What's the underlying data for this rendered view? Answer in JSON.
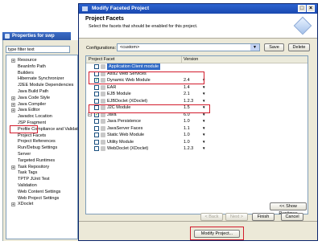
{
  "background_window": {
    "title": "Properties for swp",
    "filter_text": "type filter text",
    "tree": [
      {
        "label": "Resource",
        "expandable": true
      },
      {
        "label": "BeanInfo Path",
        "expandable": false
      },
      {
        "label": "Builders",
        "expandable": false
      },
      {
        "label": "Hibernate Synchronizer",
        "expandable": false
      },
      {
        "label": "J2EE Module Dependencies",
        "expandable": false
      },
      {
        "label": "Java Build Path",
        "expandable": false
      },
      {
        "label": "Java Code Style",
        "expandable": true
      },
      {
        "label": "Java Compiler",
        "expandable": true
      },
      {
        "label": "Java Editor",
        "expandable": true
      },
      {
        "label": "Javadoc Location",
        "expandable": false
      },
      {
        "label": "JSP Fragment",
        "expandable": false
      },
      {
        "label": "Profile Compliance and Validatio",
        "expandable": false
      },
      {
        "label": "Project Facets",
        "expandable": false
      },
      {
        "label": "Project References",
        "expandable": false
      },
      {
        "label": "Run/Debug Settings",
        "expandable": false
      },
      {
        "label": "Server",
        "expandable": false
      },
      {
        "label": "Targeted Runtimes",
        "expandable": false
      },
      {
        "label": "Task Repository",
        "expandable": true
      },
      {
        "label": "Task Tags",
        "expandable": false
      },
      {
        "label": "TPTP JUnit Test",
        "expandable": false
      },
      {
        "label": "Validation",
        "expandable": false
      },
      {
        "label": "Web Content Settings",
        "expandable": false
      },
      {
        "label": "Web Project Settings",
        "expandable": false
      },
      {
        "label": "XDoclet",
        "expandable": true
      }
    ]
  },
  "dialog": {
    "title": "Modify Faceted Project",
    "heading": "Project Facets",
    "description": "Select the facets that should be enabled for this project.",
    "config_label": "Configurations:",
    "config_value": "<custom>",
    "save_label": "Save",
    "delete_label": "Delete",
    "col_facet": "Project Facet",
    "col_version": "Version",
    "facets": [
      {
        "name": "Application Client module",
        "version": "",
        "checked": false,
        "selected": true
      },
      {
        "name": "Axis2 Web Services",
        "version": "",
        "checked": false,
        "selected": false
      },
      {
        "name": "Dynamic Web Module",
        "version": "2.4",
        "checked": true,
        "selected": false
      },
      {
        "name": "EAR",
        "version": "1.4",
        "checked": false,
        "selected": false
      },
      {
        "name": "EJB Module",
        "version": "2.1",
        "checked": false,
        "selected": false
      },
      {
        "name": "EJBDoclet (XDoclet)",
        "version": "1.2.3",
        "checked": false,
        "selected": false
      },
      {
        "name": "J2C Module",
        "version": "1.5",
        "checked": false,
        "selected": false
      },
      {
        "name": "Java",
        "version": "6.0",
        "checked": true,
        "selected": false
      },
      {
        "name": "Java Persistence",
        "version": "1.0",
        "checked": false,
        "selected": false
      },
      {
        "name": "JavaServer Faces",
        "version": "1.1",
        "checked": false,
        "selected": false
      },
      {
        "name": "Static Web Module",
        "version": "1.0",
        "checked": false,
        "selected": false
      },
      {
        "name": "Utility Module",
        "version": "1.0",
        "checked": false,
        "selected": false
      },
      {
        "name": "WebDoclet (XDoclet)",
        "version": "1.2.3",
        "checked": false,
        "selected": false
      }
    ],
    "show_runtimes_label": "<< Show Runtimes",
    "back_label": "< Back",
    "next_label": "Next >",
    "finish_label": "Finish",
    "cancel_label": "Cancel"
  },
  "modify_project_label": "Modify Project..."
}
